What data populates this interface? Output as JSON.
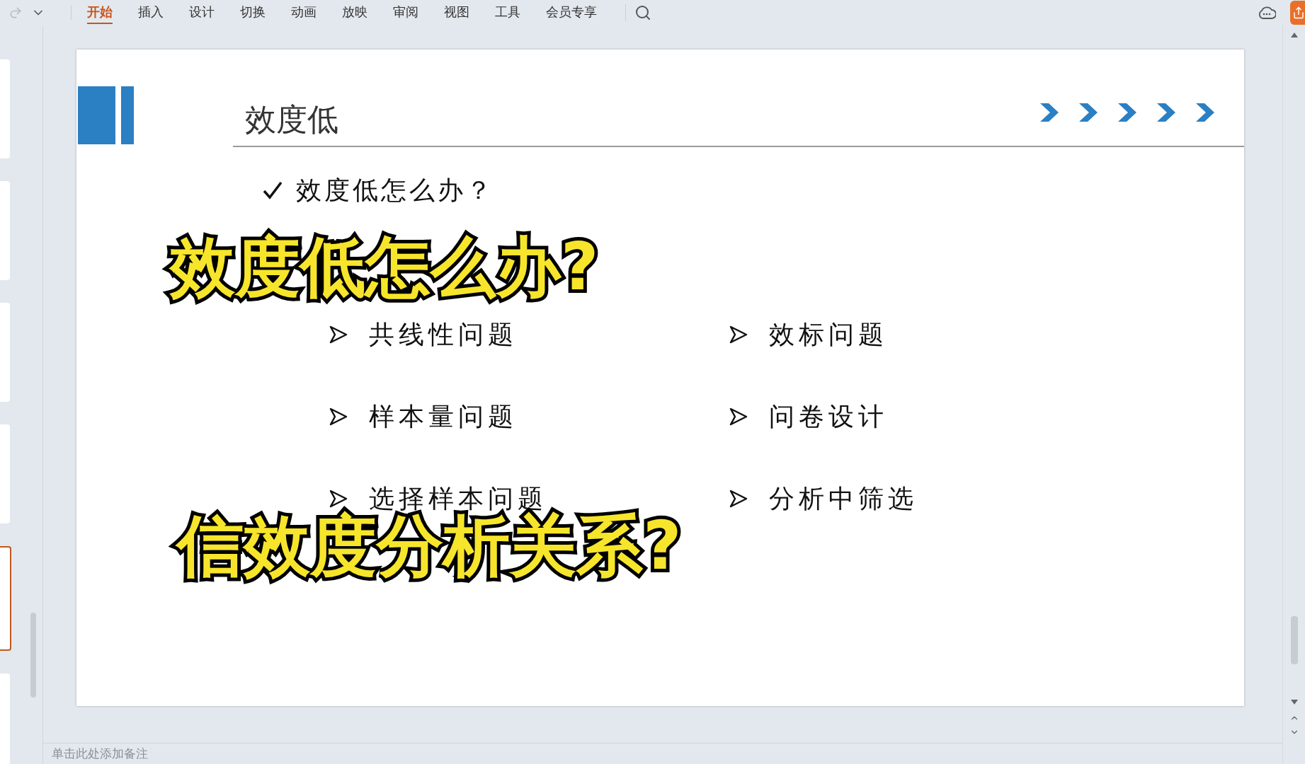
{
  "toolbar": {
    "tabs": [
      {
        "label": "开始",
        "selected": true
      },
      {
        "label": "插入",
        "selected": false
      },
      {
        "label": "设计",
        "selected": false
      },
      {
        "label": "切换",
        "selected": false
      },
      {
        "label": "动画",
        "selected": false
      },
      {
        "label": "放映",
        "selected": false
      },
      {
        "label": "审阅",
        "selected": false
      },
      {
        "label": "视图",
        "selected": false
      },
      {
        "label": "工具",
        "selected": false
      },
      {
        "label": "会员专享",
        "selected": false
      }
    ]
  },
  "slide_thumbnails": [
    {
      "selected": false
    },
    {
      "selected": false
    },
    {
      "selected": false
    },
    {
      "selected": false
    },
    {
      "selected": true
    },
    {
      "selected": false
    }
  ],
  "slide": {
    "title": "效度低",
    "question": "效度低怎么办？",
    "bullets": [
      "共线性问题",
      "效标问题",
      "样本量问题",
      "问卷设计",
      "选择样本问题",
      "分析中筛选"
    ]
  },
  "captions": [
    "效度低怎么办?",
    "信效度分析关系?"
  ],
  "notes": {
    "placeholder": "单击此处添加备注"
  }
}
